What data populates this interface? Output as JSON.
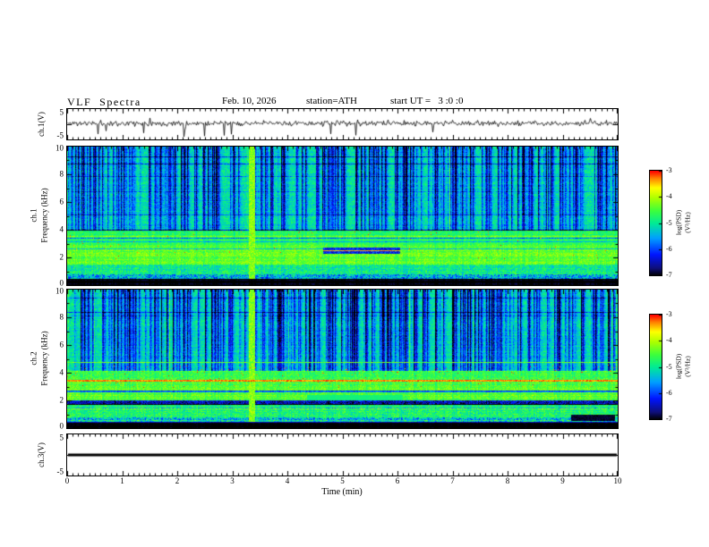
{
  "figure": {
    "background": "#ffffff"
  },
  "header": {
    "title": "VLF  Spectra",
    "date": "Feb. 10, 2026",
    "station": "station=ATH",
    "start_ut": "start UT =   3 :0 :0"
  },
  "xaxis": {
    "label": "Time (min)",
    "range": [
      0,
      10
    ],
    "major_ticks": [
      0,
      1,
      2,
      3,
      4,
      5,
      6,
      7,
      8,
      9,
      10
    ],
    "minor_step": 0.1
  },
  "colors": {
    "colormap_low_to_high": [
      "#000000",
      "#0f0f78",
      "#0014ff",
      "#00a0ff",
      "#00eb96",
      "#3cff3c",
      "#aaff00",
      "#ffff00",
      "#ff8200",
      "#ff0000"
    ],
    "frame": "#000000",
    "trace": "#000000"
  },
  "chart_data": [
    {
      "type": "line",
      "panel": "ch1-waveform",
      "ylabel": "ch.1(V)",
      "ylim": [
        -5,
        5
      ],
      "yticks": [
        5,
        -5
      ],
      "signal": {
        "seed": 11,
        "baseline_v": 0.3,
        "noise_amp_v": 0.85,
        "neg_spike_rate": 0.015,
        "neg_spike_max_v": -4.6,
        "pos_spike_rate": 0.004,
        "pos_spike_max_v": 2.2,
        "flat": false
      }
    },
    {
      "type": "heatmap",
      "panel": "ch1-spectrogram",
      "ylabel": "ch.1\nFrequency (kHz)",
      "ylim": [
        0,
        10
      ],
      "yticks": [
        10,
        8,
        6,
        4,
        2,
        0
      ],
      "colorbar": {
        "label": "log(PSD)(V²/Hz)",
        "ticks": [
          -3,
          -4,
          -5,
          -6,
          -7
        ],
        "min": -7,
        "max": -3
      },
      "seed": 22,
      "bands": [
        {
          "f_lo": 0.0,
          "f_hi": 0.42,
          "level": -6.95,
          "noise": 0.08
        },
        {
          "f_lo": 0.42,
          "f_hi": 0.8,
          "level": -5.3,
          "noise": 0.75
        },
        {
          "f_lo": 0.8,
          "f_hi": 1.5,
          "level": -4.85,
          "noise": 0.45
        },
        {
          "f_lo": 1.5,
          "f_hi": 2.9,
          "level": -4.3,
          "noise": 0.3
        },
        {
          "f_lo": 2.9,
          "f_hi": 3.95,
          "level": -4.65,
          "noise": 0.3
        },
        {
          "f_lo": 3.95,
          "f_hi": 10.01,
          "level": -5.05,
          "noise": 0.35
        }
      ],
      "streaks": {
        "f_min": 3.95,
        "density": 0.38,
        "max_depth": 1.9,
        "bright_rate": 0.02,
        "bright_amp": 1.0
      },
      "features": [
        {
          "t_lo": 3.3,
          "t_hi": 3.42,
          "f_lo": 0.45,
          "f_hi": 10,
          "level": -4.2,
          "noise": 0.35
        },
        {
          "t_lo": 4.65,
          "t_hi": 6.05,
          "f_lo": 2.25,
          "f_hi": 2.7,
          "level": -6.2,
          "noise": 0.45
        },
        {
          "t_lo": 4.65,
          "t_hi": 6.05,
          "f_lo": 2.44,
          "f_hi": 2.52,
          "level": -3.4,
          "noise": 0.2
        }
      ],
      "red_speckle": {
        "rate": 0.004,
        "f_lo": 1.9,
        "f_hi": 3.9
      }
    },
    {
      "type": "heatmap",
      "panel": "ch2-spectrogram",
      "ylabel": "ch.2\nFrequency (kHz)",
      "ylim": [
        0,
        10
      ],
      "yticks": [
        10,
        8,
        6,
        4,
        2,
        0
      ],
      "colorbar": {
        "label": "log(PSD)(V²/Hz)",
        "ticks": [
          -3,
          -4,
          -5,
          -6,
          -7
        ],
        "min": -7,
        "max": -3
      },
      "seed": 33,
      "bands": [
        {
          "f_lo": 0.0,
          "f_hi": 0.42,
          "level": -6.95,
          "noise": 0.08
        },
        {
          "f_lo": 0.42,
          "f_hi": 0.8,
          "level": -5.2,
          "noise": 0.75
        },
        {
          "f_lo": 0.8,
          "f_hi": 1.7,
          "level": -4.7,
          "noise": 0.45
        },
        {
          "f_lo": 1.7,
          "f_hi": 1.98,
          "level": -6.4,
          "noise": 0.5
        },
        {
          "f_lo": 1.98,
          "f_hi": 3.05,
          "level": -4.3,
          "noise": 0.3
        },
        {
          "f_lo": 3.05,
          "f_hi": 4.1,
          "level": -4.45,
          "noise": 0.35
        },
        {
          "f_lo": 4.1,
          "f_hi": 10.01,
          "level": -5.05,
          "noise": 0.35
        }
      ],
      "streaks": {
        "f_min": 4.1,
        "density": 0.38,
        "max_depth": 1.9,
        "bright_rate": 0.02,
        "bright_amp": 1.0
      },
      "features": [
        {
          "t_lo": 3.3,
          "t_hi": 3.42,
          "f_lo": 0.45,
          "f_hi": 10,
          "level": -4.2,
          "noise": 0.35
        },
        {
          "t_lo": 4.35,
          "t_hi": 6.1,
          "f_lo": 1.98,
          "f_hi": 2.4,
          "level": -4.85,
          "noise": 0.12
        },
        {
          "t_lo": 0,
          "t_hi": 10,
          "f_lo": 3.38,
          "f_hi": 3.5,
          "level": -3.3,
          "noise": 0.25
        },
        {
          "t_lo": 0,
          "t_hi": 10,
          "f_lo": 4.72,
          "f_hi": 4.8,
          "level": -4.3,
          "noise": 0.3
        },
        {
          "t_lo": 9.15,
          "t_hi": 9.95,
          "f_lo": 0.5,
          "f_hi": 0.95,
          "level": -6.9,
          "noise": 0.1
        }
      ],
      "red_speckle": {
        "rate": 0.012,
        "f_lo": 2.9,
        "f_hi": 4.6
      }
    },
    {
      "type": "line",
      "panel": "ch3-waveform",
      "ylabel": "ch.3(V)",
      "ylim": [
        -5,
        5
      ],
      "yticks": [
        5,
        -5
      ],
      "signal": {
        "flat": true,
        "value_v": 0,
        "line_width": 3,
        "seed": 44
      }
    }
  ]
}
